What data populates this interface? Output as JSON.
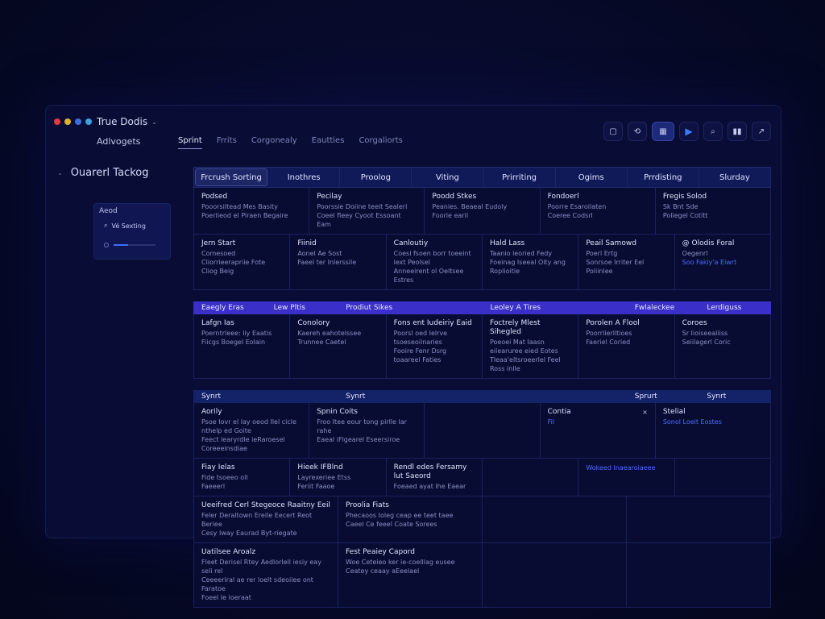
{
  "window": {
    "title": "True Dodis",
    "subnav": "Adlvogets",
    "tabs": [
      "Sprint",
      "Frrits",
      "Corgonealy",
      "Eautties",
      "Corgaliorts"
    ],
    "active_tab": 0
  },
  "toolbar": {
    "icons": [
      "calendar-icon",
      "link-icon",
      "gift-icon",
      "play-icon",
      "search-icon",
      "columns-icon",
      "export-icon"
    ],
    "glyphs": [
      "▢",
      "⟲",
      "▦",
      "▶",
      "⌕",
      "▮▮",
      "↗"
    ]
  },
  "sidebar": {
    "heading": "Ouarerl Tackog",
    "panel_label": "Aeod",
    "search_text": "Vé Sexting",
    "slider_fraction": 0.35
  },
  "columns": [
    "Frcrush Sorting",
    "Inothres",
    "Proolog",
    "Viting",
    "Prirriting",
    "Ogims",
    "Prrdisting",
    "Slurday"
  ],
  "sections": [
    {
      "bar": "",
      "bar_labels": [],
      "rows": [
        [
          {
            "t": "Podsed",
            "l": [
              "Pooorsiltead Mes Basity",
              "Poerlieod el Piraen Begaire"
            ]
          },
          {
            "t": "Pecilay",
            "l": [
              "Poorssie Doiine teeit Sealerl",
              "Coeel fleey Cyoot Essoant Eam"
            ]
          },
          {
            "t": "Poodd Stkes",
            "l": [
              "Peanies. Beaeal Eudoly",
              "Foorle earil"
            ]
          },
          {
            "t": "Fondoerl",
            "l": [
              "Poorre Esaroilaten",
              "Coeree Codsrl"
            ]
          },
          {
            "t": "Fregis Solod",
            "l": [
              "Sk Bnt Sde",
              "Poliegel Cotitt"
            ]
          }
        ],
        [
          {
            "t": "Jern Start",
            "l": [
              "Comesoed",
              "Cliorrieerapriie Fote",
              "Cliog Beig"
            ]
          },
          {
            "t": "Fiinid",
            "l": [
              "Aonel Ae Sost",
              "Faeel ter Inlerssile"
            ]
          },
          {
            "t": "Canloutiy",
            "l": [
              "Coesl fsoen borr toeeint lext Peolsel",
              "Anneeirent ol Oeltsee Estres"
            ]
          },
          {
            "t": "Hald Lass",
            "l": [
              "Taanio leoried Fedy",
              "Foeinag Iseeal Oity ang Roplioitie"
            ]
          },
          {
            "t": "Peail Samowd",
            "l": [
              "Poerl Ertg",
              "Sonrsoe Irriter Eel",
              "Poliinlee"
            ]
          },
          {
            "t": "@ Olodis Foral",
            "l": [
              "Oegenrl"
            ],
            "link": "Soo Fakiy'a Eiwrt"
          }
        ]
      ]
    },
    {
      "bar": "purple",
      "bar_labels": [
        "Eaegly Eras",
        "Lew Pltis",
        "Prodiut Sikes",
        "",
        "Leoley A Tires",
        "",
        "Fwlaleckee",
        "Lerdiguss"
      ],
      "rows": [
        [
          {
            "t": "Lafgn Ias",
            "l": [
              "Poerntrleee: liy Eaatis",
              "Fiicgs Boegel Eolain"
            ]
          },
          {
            "t": "Conolory",
            "l": [
              "Kaereh eahotelssee",
              "Trunnee Caetel"
            ]
          },
          {
            "t": "Fons ent Iudeiriy Eaid",
            "l": [
              "Poorsl oed Ielrve tsoeseoilnaries",
              "Fooire Fenr Dsrg toaareel Faties"
            ]
          },
          {
            "t": "Foctrely Mlest Sihegled",
            "l": [
              "Poeoei Mat Iaasn eiiearuree eied Eotes",
              "Tleaa'eltsroeerlel Feel Ross inlle"
            ]
          },
          {
            "t": "Porolen A Flool",
            "l": [
              "Poorrlierlltioes",
              "Faeriel Coried"
            ]
          },
          {
            "t": "Coroes",
            "l": [
              "Sr Iioiseealiiss",
              "Seiilagerl Coric"
            ]
          }
        ]
      ]
    },
    {
      "bar": "navy",
      "bar_labels": [
        "Synrt",
        "",
        "Synrt",
        "",
        "",
        "",
        "Sprurt",
        "Synrt"
      ],
      "rows": [
        [
          {
            "t": "Aorily",
            "l": [
              "Psoe Iovr el lay oeod Ilel cicle nthelp ed Goite",
              "Feect learyrdle ieRaroesel Coreeeinsdiae"
            ]
          },
          {
            "t": "Spnin Coits",
            "l": [
              "Froo Itee eour tong pirlle lar rahe",
              "Eaeal iFlgearel Eseersiroe"
            ]
          },
          {
            "t": "",
            "l": []
          },
          {
            "t": "Contia",
            "l": [],
            "link": "Fil",
            "close": "×"
          },
          {
            "t": "Stelial",
            "l": [],
            "link": "Sonol Loeit Eostes"
          }
        ],
        [
          {
            "t": "Fiay Ielas",
            "l": [
              "Fide tsoeeo oll",
              "Faeeerl"
            ]
          },
          {
            "t": "Hieek IFBlnd",
            "l": [
              "Layrexeriee Etss",
              "Feriit Faaoe"
            ]
          },
          {
            "t": "Rendl edes Fersamy lut Saeord",
            "l": [
              "Foeaed ayat lhe Eaear"
            ]
          },
          {
            "t": "",
            "l": []
          },
          {
            "t": "",
            "l": [],
            "link": "Wokeed Inaearoiaeee"
          },
          {
            "t": "",
            "l": []
          }
        ],
        [
          {
            "t": "Ueeifred Cerl Stegeoce Raaitny Eeil",
            "l": [
              "Feler Deraltown Ereile Eecert Reot Beriee",
              "Cesy Iway Eaurad Byt-riegate"
            ]
          },
          {
            "t": "Proolia Fiats",
            "l": [
              "Phecaoos Ioleg ceap ee teet taee",
              "Caeel Ce feeel Coate Sorees"
            ]
          },
          {
            "t": "",
            "l": []
          },
          {
            "t": "",
            "l": []
          }
        ],
        [
          {
            "t": "Uatilsee Aroalz",
            "l": [
              "Fleet Derisel Rtey Aedlorlell iesiy eay seli rel",
              "Ceeeeriral ae rer loelt sdeoiiee ont Faratoe",
              "Foeel Ie loeraat"
            ]
          },
          {
            "t": "Fest Peaiey Capord",
            "l": [
              "Woe Ceteieo ker ie-coelllag eusee",
              "Ceatey ceaay aEeelael"
            ]
          },
          {
            "t": "",
            "l": []
          },
          {
            "t": "",
            "l": []
          }
        ]
      ]
    }
  ],
  "colors": {
    "accent": "#3a2fc8",
    "link": "#4d6cff",
    "dots": [
      "#e03c3c",
      "#e0b030",
      "#3c6ee0",
      "#3aa0e0"
    ]
  }
}
